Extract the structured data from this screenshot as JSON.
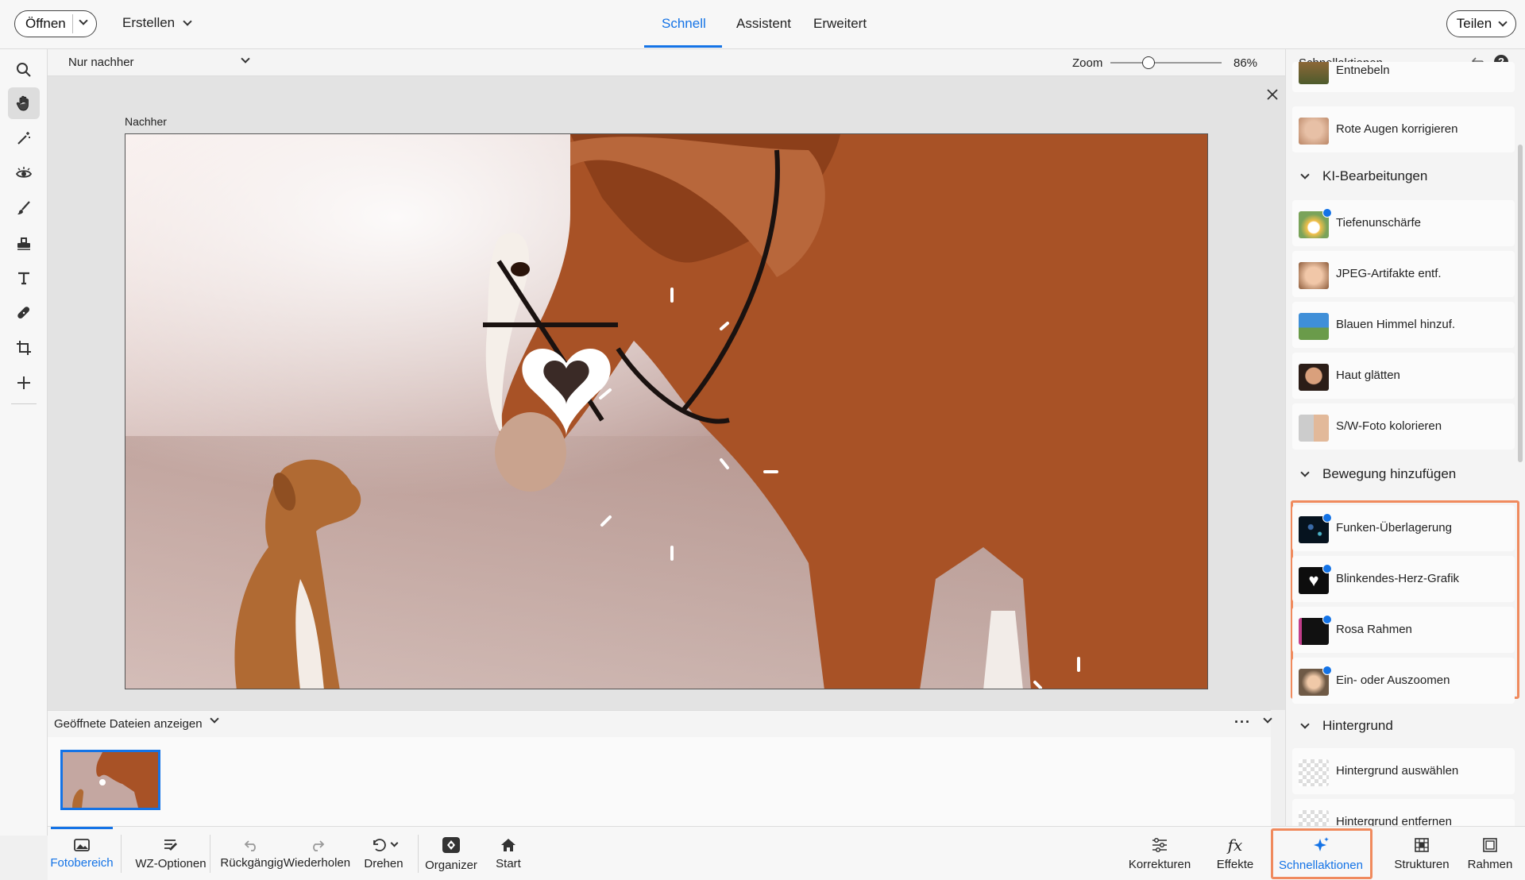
{
  "topbar": {
    "open_label": "Öffnen",
    "create_label": "Erstellen",
    "tabs": [
      "Schnell",
      "Assistent",
      "Erweitert"
    ],
    "active_tab": "Schnell",
    "share_label": "Teilen"
  },
  "options": {
    "view_select": "Nur nachher",
    "zoom_label": "Zoom",
    "zoom_value": "86%",
    "zoom_fraction": 0.34
  },
  "canvas": {
    "after_label": "Nachher"
  },
  "bin": {
    "show_label": "Geöffnete Dateien anzeigen"
  },
  "bottombar": {
    "left": [
      "Fotobereich",
      "WZ-Optionen",
      "Rückgängig",
      "Wiederholen",
      "Drehen",
      "Organizer",
      "Start"
    ],
    "right": [
      "Korrekturen",
      "Effekte",
      "Schnellaktionen",
      "Strukturen",
      "Rahmen"
    ]
  },
  "panel": {
    "title": "Schnellaktionen",
    "top_items": [
      "Entnebeln",
      "Rote Augen korrigieren"
    ],
    "sections": [
      {
        "title": "KI-Bearbeitungen",
        "items": [
          "Tiefenunschärfe",
          "JPEG-Artifakte entf.",
          "Blauen Himmel hinzuf.",
          "Haut glätten",
          "S/W-Foto kolorieren"
        ]
      },
      {
        "title": "Bewegung hinzufügen",
        "items": [
          "Funken-Überlagerung",
          "Blinkendes-Herz-Grafik",
          "Rosa Rahmen",
          "Ein- oder Auszoomen"
        ]
      },
      {
        "title": "Hintergrund",
        "items": [
          "Hintergrund auswählen",
          "Hintergrund entfernen"
        ]
      }
    ]
  },
  "colors": {
    "accent": "#1473e6",
    "highlight": "#f08a5d"
  },
  "icons": [
    "search-icon",
    "hand-icon",
    "magic-wand-icon",
    "eye-icon",
    "brush-icon",
    "stamp-icon",
    "text-icon",
    "healing-icon",
    "crop-icon",
    "move-icon",
    "close-icon",
    "more-icon",
    "chevron-down-icon",
    "undo-icon",
    "redo-icon",
    "rotate-icon",
    "organizer-icon",
    "home-icon",
    "sliders-icon",
    "fx-icon",
    "sparkle-icon",
    "pattern-icon",
    "frame-icon",
    "photo-bin-icon",
    "help-icon"
  ]
}
